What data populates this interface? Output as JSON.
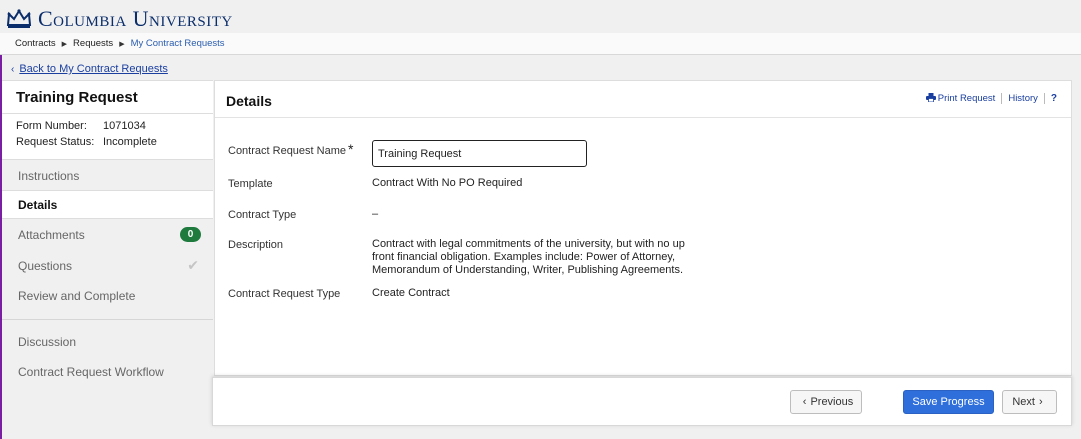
{
  "header": {
    "logo_text": "Columbia University"
  },
  "breadcrumb": [
    "Contracts",
    "Requests",
    "My Contract Requests"
  ],
  "back_link": "Back to My Contract Requests",
  "sidebar": {
    "title": "Training Request",
    "form_number_label": "Form Number:",
    "form_number": "1071034",
    "status_label": "Request Status:",
    "status": "Incomplete",
    "items": [
      {
        "label": "Instructions"
      },
      {
        "label": "Details"
      },
      {
        "label": "Attachments",
        "badge": "0"
      },
      {
        "label": "Questions"
      },
      {
        "label": "Review and Complete"
      },
      {
        "label": "Discussion"
      },
      {
        "label": "Contract Request Workflow"
      }
    ]
  },
  "panel": {
    "title": "Details",
    "print_label": "Print Request",
    "history_label": "History",
    "help_label": "?",
    "fields": {
      "name_label": "Contract Request Name",
      "name_required": "*",
      "name_value": "Training Request",
      "template_label": "Template",
      "template_value": "Contract With No PO Required",
      "type_label": "Contract Type",
      "type_value": "–",
      "description_label": "Description",
      "description_value": "Contract with legal commitments of the university, but with no up front financial obligation. Examples include: Power of Attorney, Memorandum of Understanding, Writer, Publishing Agreements.",
      "request_type_label": "Contract Request Type",
      "request_type_value": "Create Contract"
    }
  },
  "footer": {
    "previous_label": "Previous",
    "save_label": "Save Progress",
    "next_label": "Next"
  },
  "colors": {
    "brand": "#0b2e6b",
    "link": "#1a3fa0",
    "primary_button": "#2f6fdc",
    "badge": "#1f7a3e"
  }
}
